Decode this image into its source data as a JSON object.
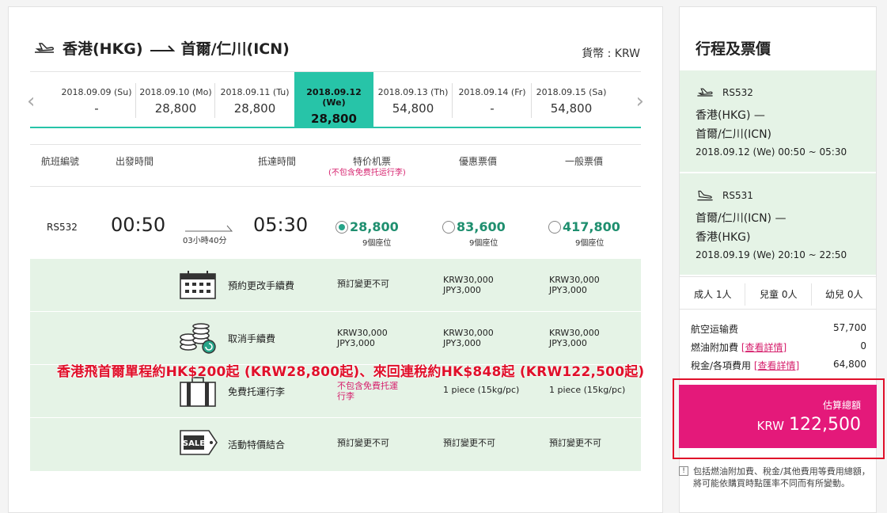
{
  "route": {
    "from": "香港(HKG)",
    "to": "首爾/仁川(ICN)"
  },
  "currency": "貨幣 : KRW",
  "dates": [
    {
      "date": "2018.09.09 (Su)",
      "price": "-"
    },
    {
      "date": "2018.09.10 (Mo)",
      "price": "28,800"
    },
    {
      "date": "2018.09.11 (Tu)",
      "price": "28,800"
    },
    {
      "date": "2018.09.12 (We)",
      "price": "28,800",
      "selected": true
    },
    {
      "date": "2018.09.13 (Th)",
      "price": "54,800"
    },
    {
      "date": "2018.09.14 (Fr)",
      "price": "-"
    },
    {
      "date": "2018.09.15 (Sa)",
      "price": "54,800"
    }
  ],
  "table_headers": {
    "flight_no": "航班編號",
    "depart": "出發時間",
    "arrive": "抵達時間",
    "special": "特价机票",
    "special_note": "(不包含免费托运行李)",
    "discount": "優惠票價",
    "regular": "一般票價"
  },
  "flight": {
    "number": "RS532",
    "depart": "00:50",
    "arrive": "05:30",
    "duration": "03小時40分",
    "fares": [
      {
        "amount": "28,800",
        "seats": "9個座位",
        "selected": true
      },
      {
        "amount": "83,600",
        "seats": "9個座位",
        "selected": false
      },
      {
        "amount": "417,800",
        "seats": "9個座位",
        "selected": false
      }
    ]
  },
  "details": [
    {
      "icon": "calendar-icon",
      "label": "預約更改手續費",
      "v1": "預訂變更不可",
      "v2": "KRW30,000\nJPY3,000",
      "v3": "KRW30,000\nJPY3,000"
    },
    {
      "icon": "coins-refund-icon",
      "label": "取消手續費",
      "v1": "KRW30,000\nJPY3,000",
      "v2": "KRW30,000\nJPY3,000",
      "v3": "KRW30,000\nJPY3,000"
    },
    {
      "icon": "luggage-icon",
      "label": "免費托運行李",
      "v1": "不包含免費托運\n行李",
      "v2": "1 piece (15kg/pc)",
      "v3": "1 piece (15kg/pc)"
    },
    {
      "icon": "sale-tag-icon",
      "label": "活動特價結合",
      "v1": "預訂變更不可",
      "v2": "預訂變更不可",
      "v3": "預訂變更不可"
    }
  ],
  "sale_tag_text": "SALE",
  "banner": "香港飛首爾單程約HK$200起 (KRW28,800起)、來回連稅約HK$848起 (KRW122,500起)",
  "summary": {
    "title": "行程及票價",
    "outbound": {
      "flight": "RS532",
      "from": "香港(HKG) —",
      "to": "首爾/仁川(ICN)",
      "time": "2018.09.12 (We) 00:50 ~ 05:30"
    },
    "inbound": {
      "flight": "RS531",
      "from": "首爾/仁川(ICN) —",
      "to": "香港(HKG)",
      "time": "2018.09.19 (We) 20:10 ~ 22:50"
    },
    "pax": {
      "adult": "成人 1人",
      "child": "兒童 0人",
      "infant": "幼兒 0人"
    },
    "fees": [
      {
        "label": "航空运输费",
        "link": "",
        "amount": "57,700"
      },
      {
        "label": "燃油附加費",
        "link": "[查看詳情]",
        "amount": "0"
      },
      {
        "label": "稅金/各項費用",
        "link": "[查看詳情]",
        "amount": "64,800"
      }
    ],
    "total_label": "估算總額",
    "total_currency": "KRW",
    "total_value": "122,500",
    "footnote": "包括燃油附加費、稅金/其他費用等費用總額，將可能依購買時點匯率不同而有所變動。"
  },
  "colors": {
    "accent": "#27c4a8",
    "detail_bg": "#e5f3e6",
    "total_bg": "#e4197a",
    "banner": "#e0102a"
  }
}
